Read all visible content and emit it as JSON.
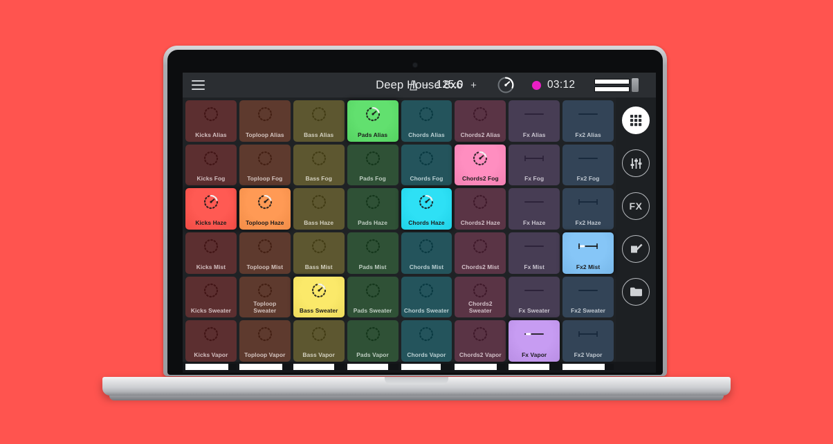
{
  "theme": {
    "backdrop": "#ff544f",
    "app_bg": "#1f2225",
    "topbar_bg": "#2b2e32",
    "rail_bg": "#1d2023",
    "record_color": "#e91ec4"
  },
  "topbar": {
    "menu_icon": "hamburger-menu-icon",
    "title": "Deep House 8x6",
    "metronome_icon": "metronome-icon",
    "tempo_decrement": "−",
    "tempo_value": "125.0",
    "tempo_increment": "+",
    "knob_icon": "tempo-knob-icon",
    "record_indicator": "record-dot",
    "elapsed_time": "03:12",
    "meter_icon": "level-meter"
  },
  "rail": {
    "items": [
      {
        "name": "grid-view-button",
        "icon": "grid-icon",
        "label": "",
        "active": true
      },
      {
        "name": "mixer-button",
        "icon": "sliders-icon",
        "label": "",
        "active": false
      },
      {
        "name": "fx-button",
        "icon": "fx-icon",
        "label": "FX",
        "active": false
      },
      {
        "name": "edit-button",
        "icon": "pencil-edit-icon",
        "label": "",
        "active": false
      },
      {
        "name": "files-button",
        "icon": "folder-icon",
        "label": "",
        "active": false
      }
    ]
  },
  "grid": {
    "columns": [
      "Kicks",
      "Toploop",
      "Bass",
      "Pads",
      "Chords",
      "Chords2",
      "Fx",
      "Fx2"
    ],
    "rows": [
      "Alias",
      "Fog",
      "Haze",
      "Mist",
      "Sweater",
      "Vapor"
    ],
    "column_colors": [
      "#5c2f30",
      "#5e3a2e",
      "#5d5730",
      "#2f5136",
      "#24545c",
      "#5a3445",
      "#473d54",
      "#334457"
    ],
    "column_active_colors": [
      "#ff5a53",
      "#ff9a55",
      "#fbe96a",
      "#62e06f",
      "#2ee0f5",
      "#ff8ec0",
      "#c79cf2",
      "#86c6f7"
    ],
    "column_kinds": [
      "knob",
      "knob",
      "knob",
      "knob",
      "knob",
      "knob",
      "slider",
      "slider"
    ],
    "cells": [
      {
        "label": "Kicks Alias",
        "col": 0,
        "row": 0,
        "active": false,
        "icon": "clip-knob-icon"
      },
      {
        "label": "Toploop Alias",
        "col": 1,
        "row": 0,
        "active": false,
        "icon": "clip-knob-icon"
      },
      {
        "label": "Bass Alias",
        "col": 2,
        "row": 0,
        "active": false,
        "icon": "clip-knob-icon"
      },
      {
        "label": "Pads Alias",
        "col": 3,
        "row": 0,
        "active": true,
        "icon": "clip-knob-playing-icon"
      },
      {
        "label": "Chords Alias",
        "col": 4,
        "row": 0,
        "active": false,
        "icon": "clip-knob-icon"
      },
      {
        "label": "Chords2 Alias",
        "col": 5,
        "row": 0,
        "active": false,
        "icon": "clip-knob-icon"
      },
      {
        "label": "Fx Alias",
        "col": 6,
        "row": 0,
        "active": false,
        "icon": "fx-slider-icon"
      },
      {
        "label": "Fx2 Alias",
        "col": 7,
        "row": 0,
        "active": false,
        "icon": "fx-slider-icon"
      },
      {
        "label": "Kicks Fog",
        "col": 0,
        "row": 1,
        "active": false,
        "icon": "clip-knob-icon"
      },
      {
        "label": "Toploop Fog",
        "col": 1,
        "row": 1,
        "active": false,
        "icon": "clip-knob-icon"
      },
      {
        "label": "Bass Fog",
        "col": 2,
        "row": 1,
        "active": false,
        "icon": "clip-knob-icon"
      },
      {
        "label": "Pads Fog",
        "col": 3,
        "row": 1,
        "active": false,
        "icon": "clip-knob-icon"
      },
      {
        "label": "Chords Fog",
        "col": 4,
        "row": 1,
        "active": false,
        "icon": "clip-knob-icon"
      },
      {
        "label": "Chords2 Fog",
        "col": 5,
        "row": 1,
        "active": true,
        "icon": "clip-knob-playing-icon"
      },
      {
        "label": "Fx Fog",
        "col": 6,
        "row": 1,
        "active": false,
        "icon": "fx-slider-ranged-icon"
      },
      {
        "label": "Fx2 Fog",
        "col": 7,
        "row": 1,
        "active": false,
        "icon": "fx-slider-icon"
      },
      {
        "label": "Kicks Haze",
        "col": 0,
        "row": 2,
        "active": true,
        "icon": "clip-knob-playing-icon"
      },
      {
        "label": "Toploop Haze",
        "col": 1,
        "row": 2,
        "active": true,
        "icon": "clip-knob-playing-icon"
      },
      {
        "label": "Bass Haze",
        "col": 2,
        "row": 2,
        "active": false,
        "icon": "clip-knob-icon"
      },
      {
        "label": "Pads Haze",
        "col": 3,
        "row": 2,
        "active": false,
        "icon": "clip-knob-icon"
      },
      {
        "label": "Chords Haze",
        "col": 4,
        "row": 2,
        "active": true,
        "icon": "clip-knob-playing-icon"
      },
      {
        "label": "Chords2 Haze",
        "col": 5,
        "row": 2,
        "active": false,
        "icon": "clip-knob-icon"
      },
      {
        "label": "Fx Haze",
        "col": 6,
        "row": 2,
        "active": false,
        "icon": "fx-slider-icon"
      },
      {
        "label": "Fx2 Haze",
        "col": 7,
        "row": 2,
        "active": false,
        "icon": "fx-slider-ranged-icon"
      },
      {
        "label": "Kicks Mist",
        "col": 0,
        "row": 3,
        "active": false,
        "icon": "clip-knob-icon"
      },
      {
        "label": "Toploop Mist",
        "col": 1,
        "row": 3,
        "active": false,
        "icon": "clip-knob-icon"
      },
      {
        "label": "Bass Mist",
        "col": 2,
        "row": 3,
        "active": false,
        "icon": "clip-knob-icon"
      },
      {
        "label": "Pads Mist",
        "col": 3,
        "row": 3,
        "active": false,
        "icon": "clip-knob-icon"
      },
      {
        "label": "Chords Mist",
        "col": 4,
        "row": 3,
        "active": false,
        "icon": "clip-knob-icon"
      },
      {
        "label": "Chords2 Mist",
        "col": 5,
        "row": 3,
        "active": false,
        "icon": "clip-knob-icon"
      },
      {
        "label": "Fx Mist",
        "col": 6,
        "row": 3,
        "active": false,
        "icon": "fx-slider-icon"
      },
      {
        "label": "Fx2 Mist",
        "col": 7,
        "row": 3,
        "active": true,
        "icon": "fx-slider-ranged-playing-icon"
      },
      {
        "label": "Kicks Sweater",
        "col": 0,
        "row": 4,
        "active": false,
        "icon": "clip-knob-icon"
      },
      {
        "label": "Toploop Sweater",
        "col": 1,
        "row": 4,
        "active": false,
        "icon": "clip-knob-icon"
      },
      {
        "label": "Bass Sweater",
        "col": 2,
        "row": 4,
        "active": true,
        "icon": "clip-knob-playing-icon"
      },
      {
        "label": "Pads Sweater",
        "col": 3,
        "row": 4,
        "active": false,
        "icon": "clip-knob-icon"
      },
      {
        "label": "Chords Sweater",
        "col": 4,
        "row": 4,
        "active": false,
        "icon": "clip-knob-icon"
      },
      {
        "label": "Chords2 Sweater",
        "col": 5,
        "row": 4,
        "active": false,
        "icon": "clip-knob-icon"
      },
      {
        "label": "Fx Sweater",
        "col": 6,
        "row": 4,
        "active": false,
        "icon": "fx-slider-icon"
      },
      {
        "label": "Fx2 Sweater",
        "col": 7,
        "row": 4,
        "active": false,
        "icon": "fx-slider-icon"
      },
      {
        "label": "Kicks Vapor",
        "col": 0,
        "row": 5,
        "active": false,
        "icon": "clip-knob-icon"
      },
      {
        "label": "Toploop Vapor",
        "col": 1,
        "row": 5,
        "active": false,
        "icon": "clip-knob-icon"
      },
      {
        "label": "Bass Vapor",
        "col": 2,
        "row": 5,
        "active": false,
        "icon": "clip-knob-icon"
      },
      {
        "label": "Pads Vapor",
        "col": 3,
        "row": 5,
        "active": false,
        "icon": "clip-knob-icon"
      },
      {
        "label": "Chords Vapor",
        "col": 4,
        "row": 5,
        "active": false,
        "icon": "clip-knob-icon"
      },
      {
        "label": "Chords2 Vapor",
        "col": 5,
        "row": 5,
        "active": false,
        "icon": "clip-knob-icon"
      },
      {
        "label": "Fx Vapor",
        "col": 6,
        "row": 5,
        "active": true,
        "icon": "fx-slider-playing-icon"
      },
      {
        "label": "Fx2 Vapor",
        "col": 7,
        "row": 5,
        "active": false,
        "icon": "fx-slider-ranged-icon"
      }
    ]
  },
  "bottom_bars": {
    "name": "track-position-bars",
    "fill_percents": [
      84,
      84,
      80,
      80,
      78,
      82,
      80,
      82
    ]
  }
}
